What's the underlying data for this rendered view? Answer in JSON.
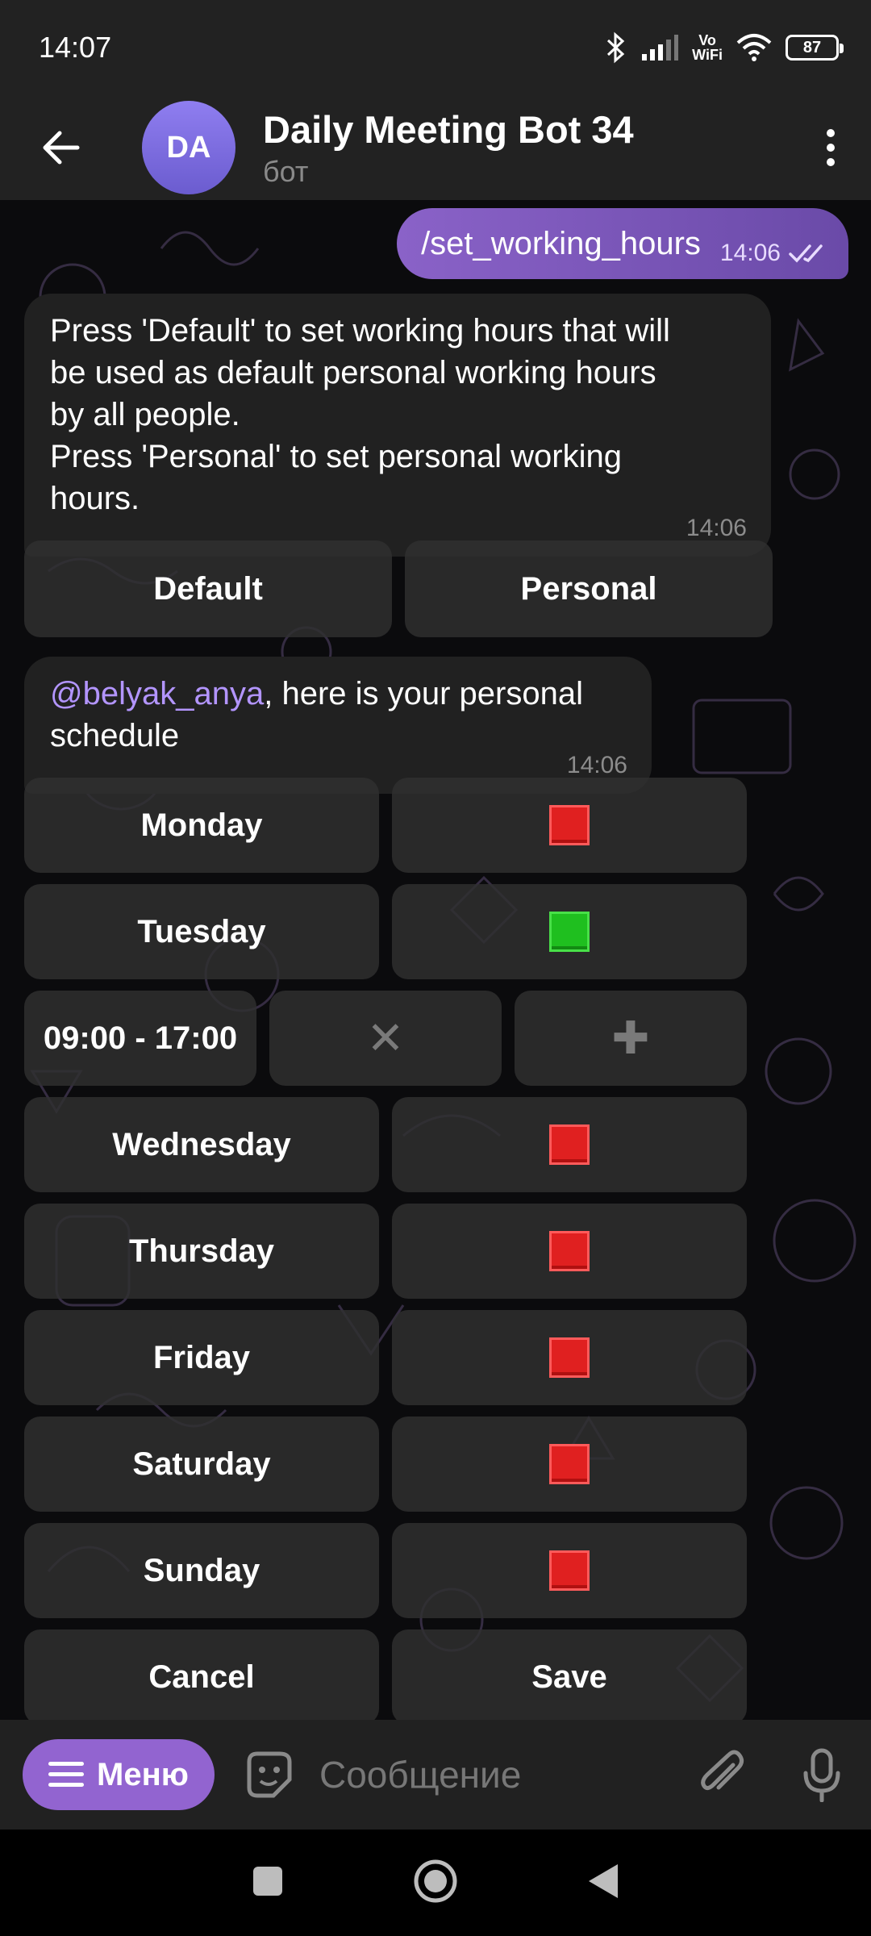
{
  "status_bar": {
    "time": "14:07",
    "battery": "87",
    "network_label_top": "Vo",
    "network_label_bottom": "WiFi"
  },
  "header": {
    "avatar_initials": "DA",
    "title": "Daily Meeting Bot 34",
    "subtitle": "бот"
  },
  "messages": {
    "command": {
      "text": "/set_working_hours",
      "time": "14:06"
    },
    "intro": {
      "text": "Press 'Default' to set working hours that will\nbe used as default personal working hours\nby all people.\nPress 'Personal' to set personal working\nhours.",
      "time": "14:06",
      "buttons": {
        "default": "Default",
        "personal": "Personal"
      }
    },
    "schedule": {
      "mention": "@belyak_anya",
      "text": ", here is your personal\nschedule",
      "time": "14:06"
    }
  },
  "schedule_keyboard": {
    "days": [
      {
        "label": "Monday",
        "enabled": false
      },
      {
        "label": "Tuesday",
        "enabled": true
      },
      {
        "label": "Wednesday",
        "enabled": false
      },
      {
        "label": "Thursday",
        "enabled": false
      },
      {
        "label": "Friday",
        "enabled": false
      },
      {
        "label": "Saturday",
        "enabled": false
      },
      {
        "label": "Sunday",
        "enabled": false
      }
    ],
    "tuesday_hours": "09:00 - 17:00",
    "remove_symbol": "✕",
    "add_symbol": "✚",
    "cancel": "Cancel",
    "save": "Save"
  },
  "input_bar": {
    "menu_label": "Меню",
    "placeholder": "Сообщение"
  },
  "colors": {
    "accent": "#9264d0",
    "header_bg": "#222222",
    "disabled_day": "#e02020",
    "enabled_day": "#1fbf1f"
  }
}
